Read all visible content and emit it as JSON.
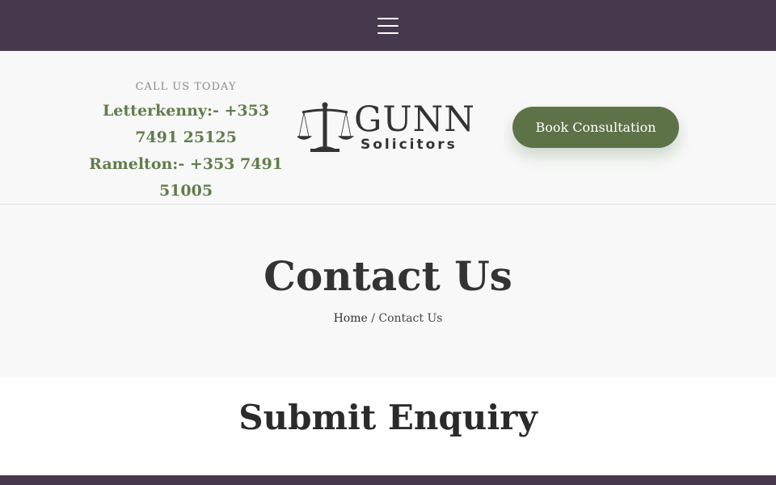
{
  "nav": {
    "menu_icon": "hamburger-menu-icon"
  },
  "header": {
    "call_label": "CALL US TODAY",
    "phones": "Letterkenny:- +353 7491 25125 Ramelton:- +353 7491 51005",
    "logo": {
      "main": "GUNN",
      "sub": "Solicitors",
      "icon": "scales-of-justice-icon"
    },
    "cta_label": "Book Consultation"
  },
  "hero": {
    "title": "Contact Us",
    "breadcrumb": {
      "home": "Home",
      "separator": " / ",
      "current": "Contact Us"
    }
  },
  "enquiry": {
    "title": "Submit Enquiry"
  },
  "colors": {
    "topbar": "#47394d",
    "accent_green": "#617d4c",
    "button_green": "#5e7248",
    "background": "#f8f8f8"
  }
}
